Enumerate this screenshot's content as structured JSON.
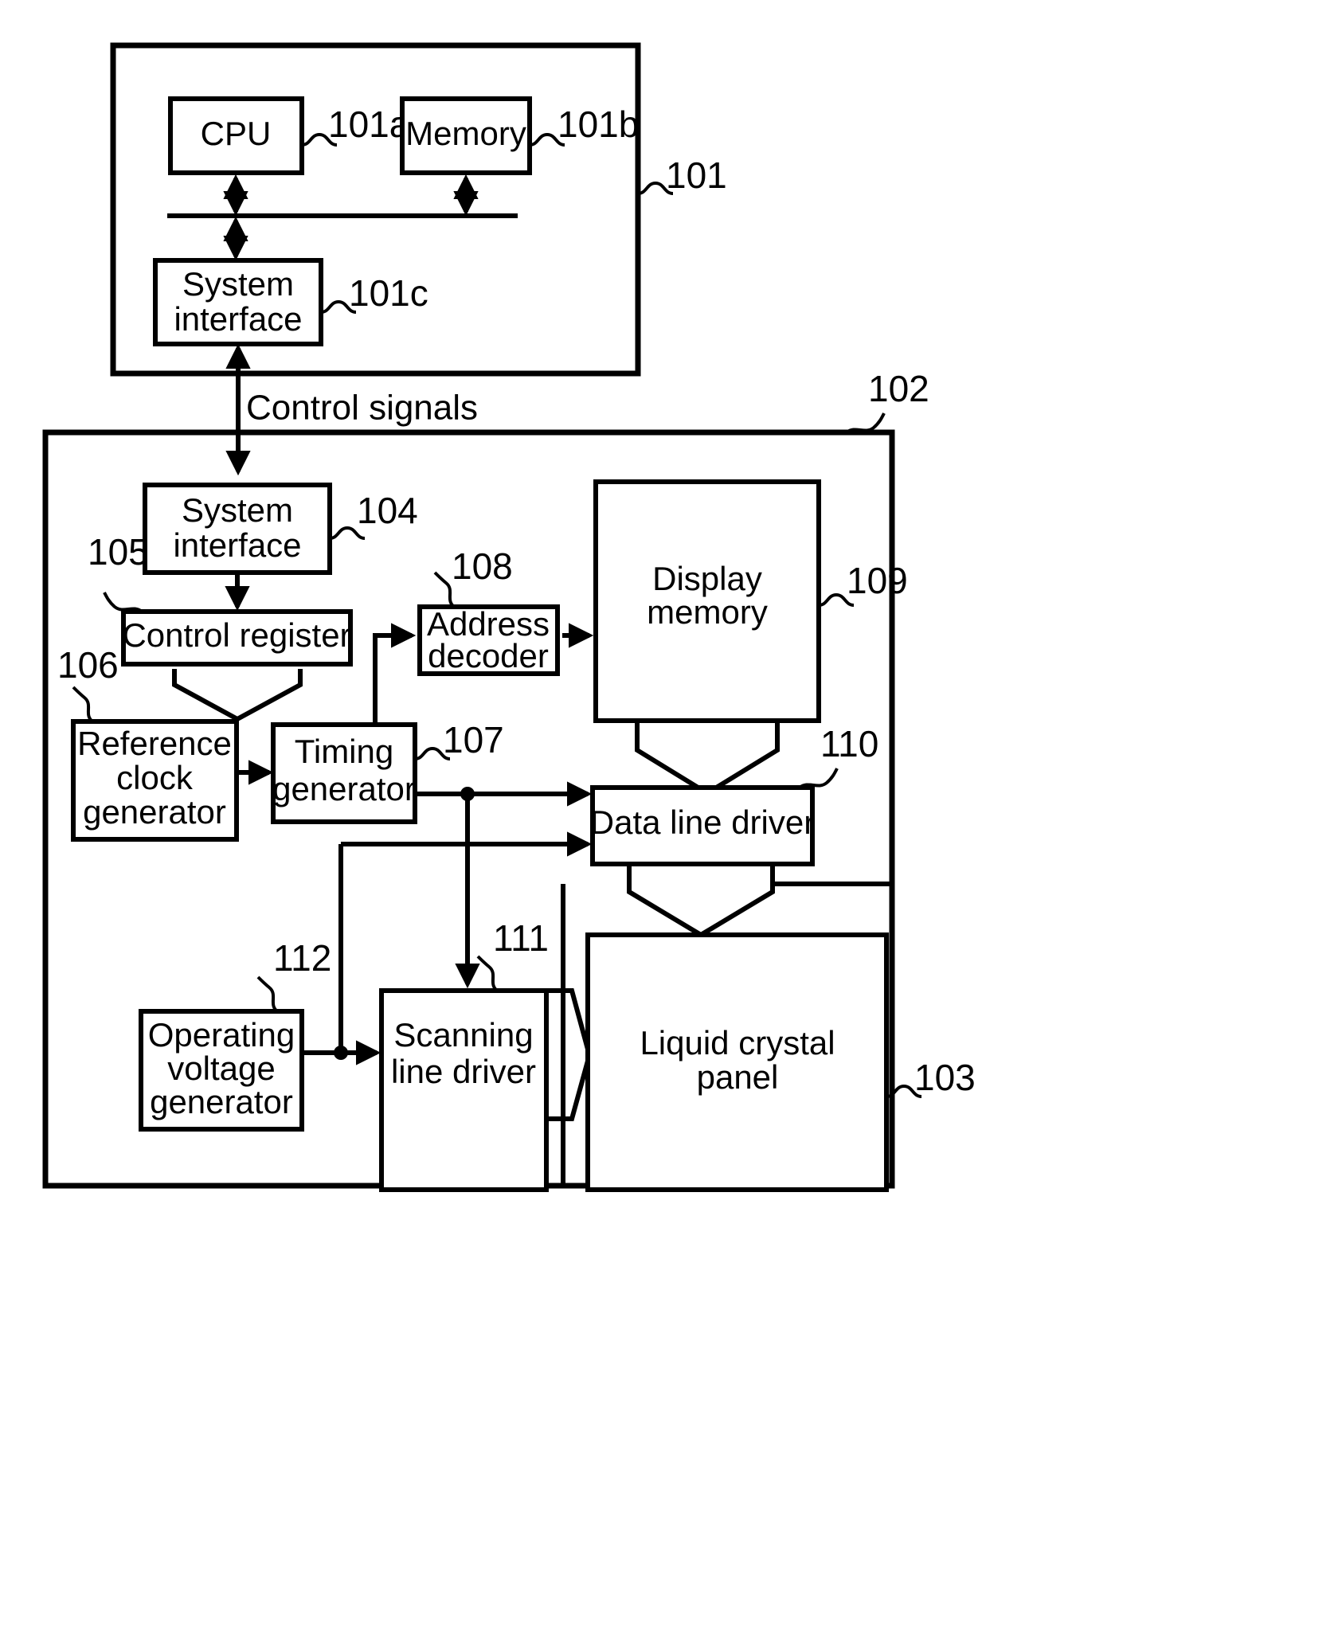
{
  "figure": {
    "type": "patent-block-diagram",
    "background_color": "#ffffff",
    "line_color": "#000000"
  },
  "blocks": {
    "cpu": {
      "label": "CPU",
      "ref": "101a"
    },
    "memory": {
      "label": "Memory",
      "ref": "101b"
    },
    "host_system_interface": {
      "label_line1": "System",
      "label_line2": "interface",
      "ref": "101c"
    },
    "host_container": {
      "ref": "101"
    },
    "controller_container": {
      "ref": "102"
    },
    "system_interface": {
      "label_line1": "System",
      "label_line2": "interface",
      "ref": "104"
    },
    "control_register": {
      "label": "Control register",
      "ref": "105"
    },
    "reference_clock_generator": {
      "label_line1": "Reference",
      "label_line2": "clock",
      "label_line3": "generator",
      "ref": "106"
    },
    "timing_generator": {
      "label_line1": "Timing",
      "label_line2": "generator",
      "ref": "107"
    },
    "address_decoder": {
      "label_line1": "Address",
      "label_line2": "decoder",
      "ref": "108"
    },
    "display_memory": {
      "label_line1": "Display",
      "label_line2": "memory",
      "ref": "109"
    },
    "data_line_driver": {
      "label": "Data line driver",
      "ref": "110"
    },
    "scanning_line_driver": {
      "label_line1": "Scanning",
      "label_line2": "line driver",
      "ref": "111"
    },
    "operating_voltage_generator": {
      "label_line1": "Operating",
      "label_line2": "voltage",
      "label_line3": "generator",
      "ref": "112"
    },
    "liquid_crystal_panel": {
      "label_line1": "Liquid crystal",
      "label_line2": "panel",
      "ref": "103"
    }
  },
  "signals": {
    "control_signals": "Control signals"
  },
  "reference_numerals": [
    "101",
    "101a",
    "101b",
    "101c",
    "102",
    "103",
    "104",
    "105",
    "106",
    "107",
    "108",
    "109",
    "110",
    "111",
    "112"
  ]
}
